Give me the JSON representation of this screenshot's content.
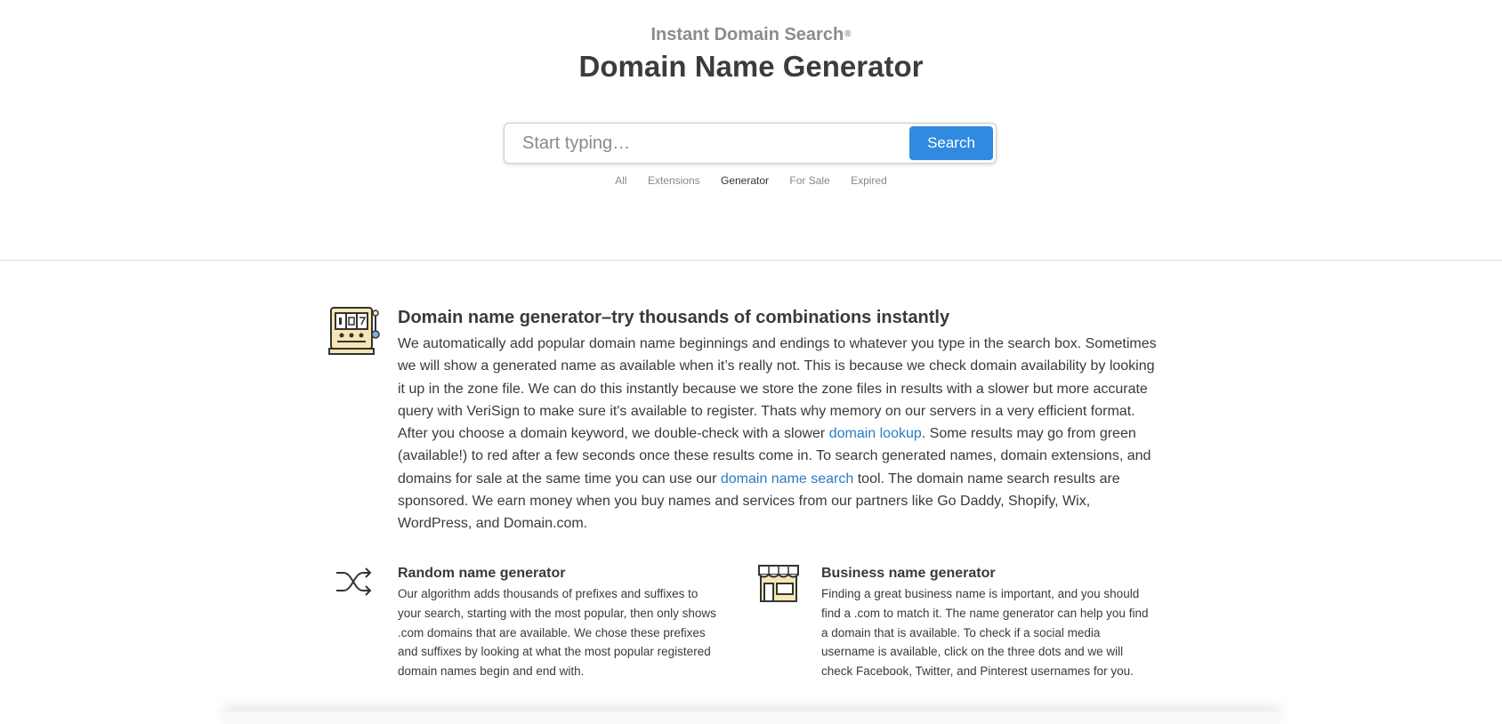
{
  "header": {
    "brand": "Instant Domain Search",
    "trademark": "®",
    "title": "Domain Name Generator"
  },
  "search": {
    "placeholder": "Start typing…",
    "button_label": "Search"
  },
  "tabs": [
    {
      "label": "All",
      "active": false
    },
    {
      "label": "Extensions",
      "active": false
    },
    {
      "label": "Generator",
      "active": true
    },
    {
      "label": "For Sale",
      "active": false
    },
    {
      "label": "Expired",
      "active": false
    }
  ],
  "main_section": {
    "icon": "slot-machine-icon",
    "heading": "Domain name generator–try thousands of combinations instantly",
    "text_1": "We automatically add popular domain name beginnings and endings to whatever you type in the search box. Sometimes we will show a generated name as available when it’s really not. This is because we check domain availability by looking it up in the zone file. We can do this instantly because we store the zone files in results with a slower but more accurate query with VeriSign to make sure it's available to register. Thats why memory on our servers in a very efficient format. After you choose a domain keyword, we double-check with a slower ",
    "link_1": "domain lookup",
    "text_2": ". Some results may go from green (available!) to red after a few seconds once these results come in. To search generated names, domain extensions, and domains for sale at the same time you can use our ",
    "link_2": "domain name search",
    "text_3": " tool. The domain name search results are sponsored. We earn money when you buy names and services from our partners like Go Daddy, Shopify, Wix, WordPress, and Domain.com."
  },
  "features": [
    {
      "icon": "shuffle-icon",
      "heading": "Random name generator",
      "text": "Our algorithm adds thousands of prefixes and suffixes to your search, starting with the most popular, then only shows .com domains that are available. We chose these prefixes and suffixes by looking at what the most popular registered domain names begin and end with."
    },
    {
      "icon": "storefront-icon",
      "heading": "Business name generator",
      "text": "Finding a great business name is important, and you should find a .com to match it. The name generator can help you find a domain that is available. To check if a social media username is available, click on the three dots and we will check Facebook, Twitter, and Pinterest usernames for you."
    }
  ],
  "colors": {
    "accent": "#2f8ae0",
    "link": "#2b7bc2",
    "text": "#3a3a3a",
    "icon_fill": "#f6e6b4"
  }
}
